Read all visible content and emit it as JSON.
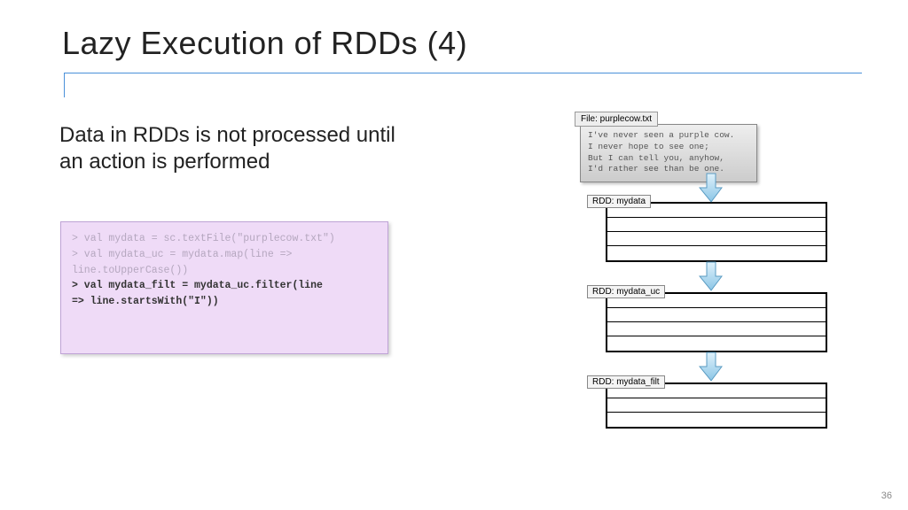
{
  "title": "Lazy Execution of RDDs (4)",
  "body_text": "Data in RDDs is not processed until an action is performed",
  "code": {
    "line1": "> val mydata = sc.textFile(\"purplecow.txt\")",
    "line2": "> val mydata_uc = mydata.map(line =>",
    "line3": "   line.toUpperCase())",
    "line4": "> val mydata_filt = mydata_uc.filter(line",
    "line5": "   => line.startsWith(\"I\"))"
  },
  "diagram": {
    "file_label": "File: purplecow.txt",
    "file_lines": {
      "l1": "I've never seen a purple cow.",
      "l2": "I never hope to see one;",
      "l3": "But I can tell you, anyhow,",
      "l4": "I'd rather see than be one."
    },
    "rdd1_label": "RDD: mydata",
    "rdd2_label": "RDD: mydata_uc",
    "rdd3_label": "RDD: mydata_filt"
  },
  "page_number": "36"
}
